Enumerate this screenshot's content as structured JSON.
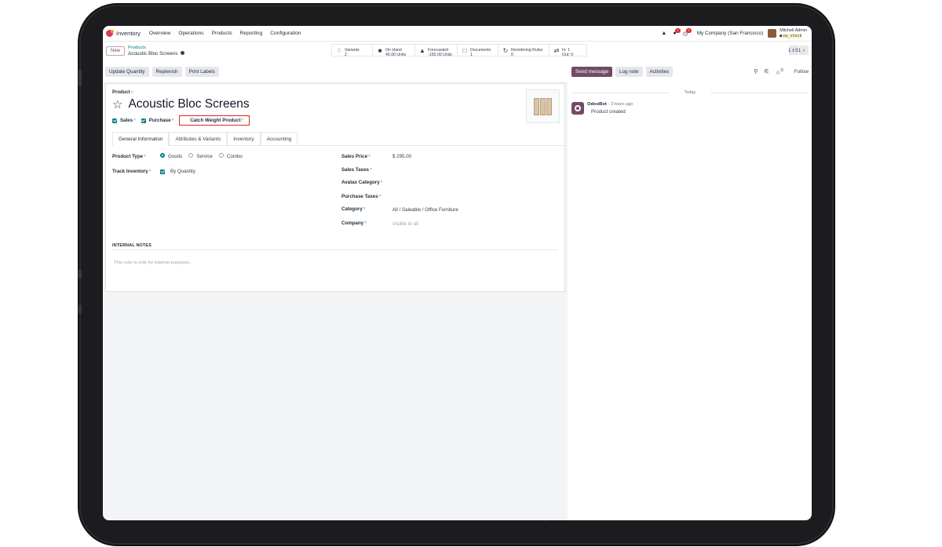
{
  "navbar": {
    "app": "Inventory",
    "menu": [
      "Overview",
      "Operations",
      "Products",
      "Reporting",
      "Configuration"
    ],
    "messages_badge": "2",
    "activities_badge": "9",
    "company": "My Company (San Francisco)",
    "user_name": "Mitchell Admin",
    "db_name": "cw_stock"
  },
  "control": {
    "new_label": "New",
    "breadcrumb_parent": "Products",
    "breadcrumb_current": "Acoustic Bloc Screens",
    "pager": "1 / 31",
    "smart_buttons": {
      "variants_label": "Variants",
      "variants_value": "2",
      "onhand_label": "On Hand",
      "onhand_value": "45.00 Units",
      "forecast_label": "Forecasted",
      "forecast_value": "-155.00 Units",
      "documents_label": "Documents",
      "documents_value": "1",
      "rules_label": "Reordering Rules",
      "rules_value": "0",
      "in_label": "In: 1",
      "out_label": "Out: 0"
    }
  },
  "actions": {
    "update_qty": "Update Quantity",
    "replenish": "Replenish",
    "print_labels": "Print Labels"
  },
  "chatter": {
    "send_message": "Send message",
    "log_note": "Log note",
    "activities": "Activities",
    "attachments_count": "0",
    "follow": "Follow",
    "today": "Today",
    "author": "OdooBot",
    "time": "- 3 hours ago",
    "body": "Product created"
  },
  "form": {
    "product_label": "Product",
    "product_name": "Acoustic Bloc Screens",
    "sales_label": "Sales",
    "purchase_label": "Purchase",
    "catch_weight_label": "Catch Weight Product",
    "tabs": [
      "General Information",
      "Attributes & Variants",
      "Inventory",
      "Accounting"
    ],
    "product_type_label": "Product Type",
    "type_goods": "Goods",
    "type_service": "Service",
    "type_combo": "Combo",
    "track_inventory_label": "Track Inventory",
    "track_by": "By Quantity",
    "sales_price_label": "Sales Price",
    "sales_price": "$ 295.00",
    "sales_taxes_label": "Sales Taxes",
    "avatax_label": "Avatax Category",
    "purchase_taxes_label": "Purchase Taxes",
    "category_label": "Category",
    "category_value": "All / Saleable / Office Furniture",
    "company_label": "Company",
    "company_placeholder": "Visible to all",
    "internal_notes_title": "INTERNAL NOTES",
    "internal_notes_placeholder": "This note is only for internal purposes."
  },
  "colors": {
    "brand": "#714b67",
    "accent": "#017e84",
    "highlight_border": "#dc2626"
  }
}
